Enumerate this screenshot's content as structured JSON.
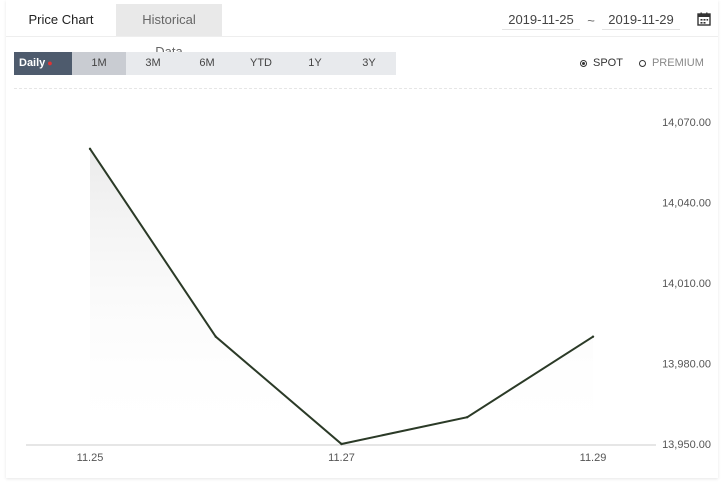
{
  "tabs": [
    {
      "label": "Price Chart",
      "active": true
    },
    {
      "label": "Historical Data",
      "active": false
    }
  ],
  "date_range": {
    "start": "2019-11-25",
    "separator": "~",
    "end": "2019-11-29"
  },
  "calendar_icon": "calendar-icon",
  "periods": [
    {
      "label": "Daily",
      "active": true,
      "marker": "●"
    },
    {
      "label": "1M"
    },
    {
      "label": "3M"
    },
    {
      "label": "6M"
    },
    {
      "label": "YTD"
    },
    {
      "label": "1Y"
    },
    {
      "label": "3Y"
    }
  ],
  "radios": [
    {
      "label": "SPOT",
      "checked": true
    },
    {
      "label": "PREMIUM",
      "checked": false
    }
  ],
  "colors": {
    "line": "#2b3a27",
    "axis": "#cccccc",
    "active_period": "#4e5b6d",
    "marker": "#e03434"
  },
  "chart_data": {
    "type": "line",
    "x": [
      "11.25",
      "11.26",
      "11.27",
      "11.28",
      "11.29"
    ],
    "x_tick_labels": [
      "11.25",
      "11.27",
      "11.29"
    ],
    "series": [
      {
        "values": [
          14060,
          13990,
          13950,
          13960,
          13990
        ]
      }
    ],
    "y_tick_labels": [
      "14,070.00",
      "14,040.00",
      "14,010.00",
      "13,980.00",
      "13,950.00"
    ],
    "ylim": [
      13950,
      14070
    ],
    "y_axis_position": "right",
    "grid": false,
    "area_fill": true
  }
}
